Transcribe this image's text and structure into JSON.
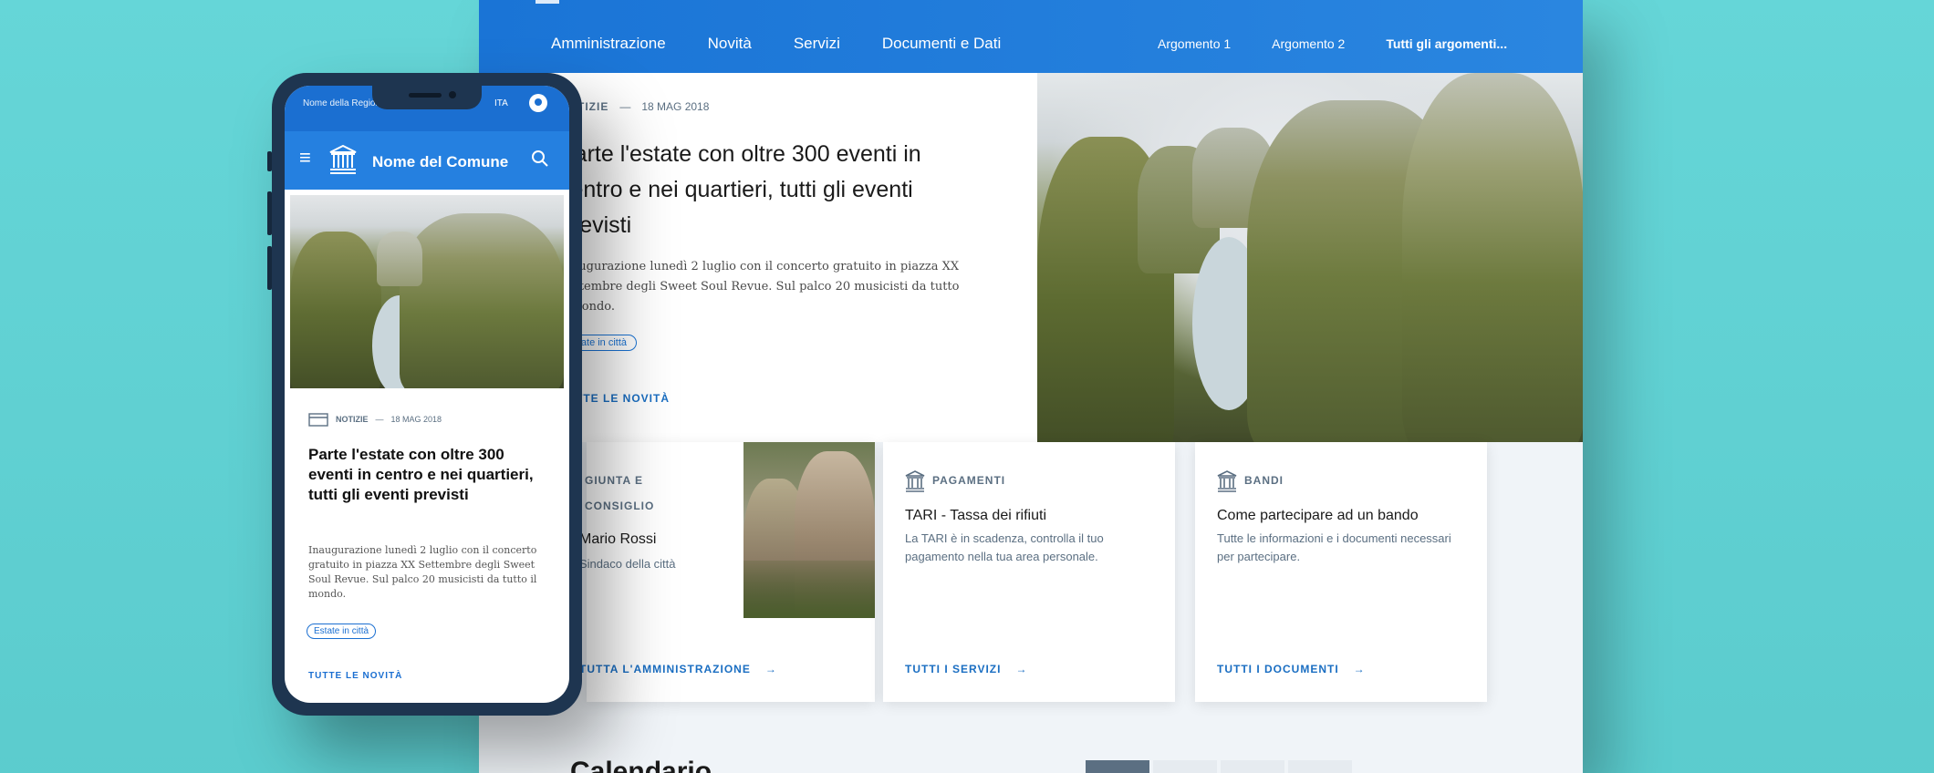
{
  "colors": {
    "background": "#5fd4d6",
    "primary": "#1a74d6",
    "link": "#1a6ec2"
  },
  "desktop": {
    "nav": [
      "Amministrazione",
      "Novità",
      "Servizi",
      "Documenti e Dati"
    ],
    "topics": [
      "Argomento 1",
      "Argomento 2",
      "Tutti gli argomenti..."
    ],
    "hero": {
      "category": "NOTIZIE",
      "date": "18 MAG 2018",
      "title": "Parte l'estate con oltre 300 eventi in centro e nei quartieri, tutti gli eventi previsti",
      "abstract": "Inaugurazione lunedì 2 luglio con il concerto gratuito in piazza XX Settembre degli Sweet Soul Revue. Sul palco 20 musicisti da tutto il mondo.",
      "tag": "Estate in città",
      "link": "TUTTE LE NOVITÀ"
    },
    "cards": [
      {
        "category": "GIUNTA E CONSIGLIO",
        "title": "Mario Rossi",
        "text": "Sindaco della città",
        "link": "TUTTA L'AMMINISTRAZIONE",
        "icon": "building-icon",
        "arrow": "→"
      },
      {
        "category": "PAGAMENTI",
        "title": "TARI - Tassa dei rifiuti",
        "text": "La TARI è in scadenza, controlla il tuo pagamento nella tua area personale.",
        "link": "TUTTI I SERVIZI",
        "icon": "building-icon",
        "arrow": "→"
      },
      {
        "category": "BANDI",
        "title": "Come partecipare ad un bando",
        "text": "Tutte le informazioni e i documenti necessari per partecipare.",
        "link": "TUTTI I DOCUMENTI",
        "icon": "building-icon",
        "arrow": "→"
      }
    ],
    "bottom_title": "Calendario"
  },
  "phone": {
    "region": "Nome della Regione",
    "lang": "ITA",
    "comune": "Nome del Comune",
    "category": "NOTIZIE",
    "date": "18 MAG 2018",
    "title": "Parte l'estate con oltre 300 eventi in centro e nei quartieri, tutti gli eventi previsti",
    "abstract": "Inaugurazione lunedì 2 luglio con il concerto gratuito in piazza XX Settembre degli Sweet Soul Revue. Sul palco 20 musicisti da tutto il mondo.",
    "tag": "Estate in città",
    "link": "TUTTE LE NOVITÀ",
    "burger": "≡"
  }
}
